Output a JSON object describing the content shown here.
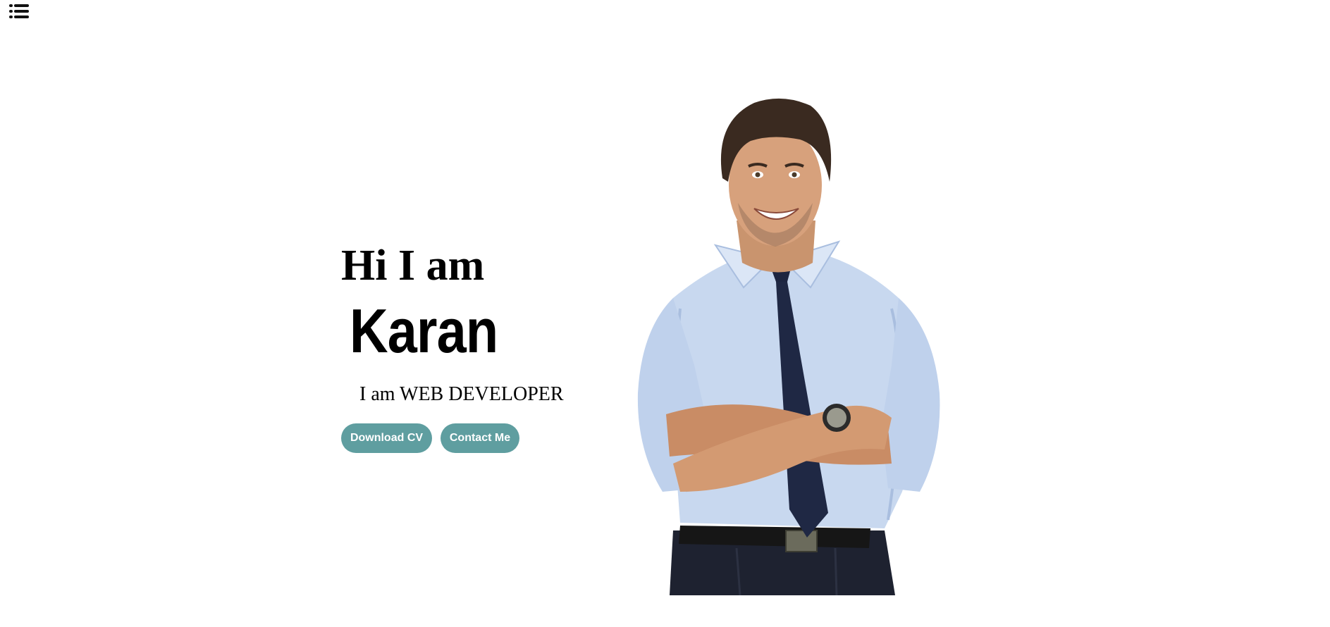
{
  "nav": {
    "menu_icon": "list-icon"
  },
  "hero": {
    "greeting": "Hi I am",
    "name": "Karan",
    "role": "I am WEB DEVELOPER",
    "buttons": {
      "download_cv": "Download CV",
      "contact_me": "Contact Me"
    }
  },
  "colors": {
    "button_bg": "#5f9ea0",
    "button_text": "#ffffff",
    "text": "#000000",
    "background": "#ffffff"
  }
}
